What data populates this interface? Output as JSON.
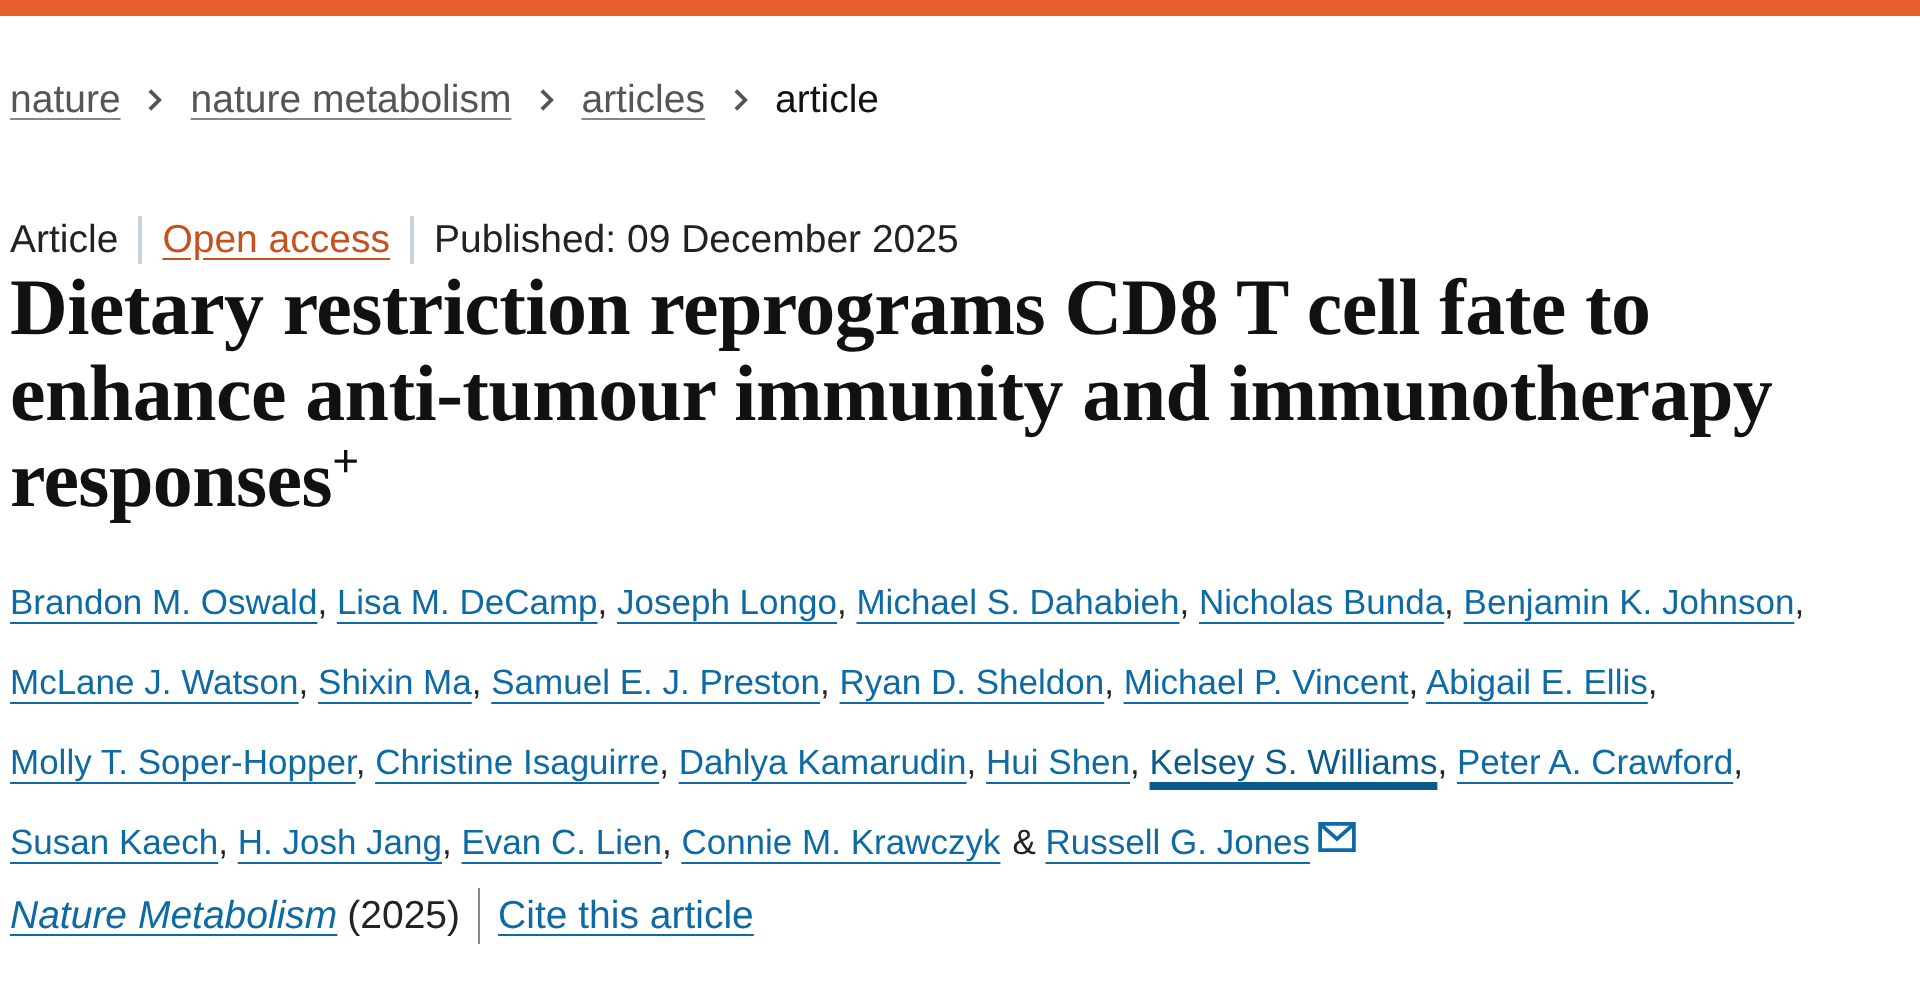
{
  "breadcrumb": [
    {
      "label": "nature",
      "current": false
    },
    {
      "label": "nature metabolism",
      "current": false
    },
    {
      "label": "articles",
      "current": false
    },
    {
      "label": "article",
      "current": true
    }
  ],
  "article_meta": {
    "type": "Article",
    "access": "Open access",
    "published": "Published: 09 December 2025"
  },
  "title": "Dietary restriction reprograms CD8 T cell fate to enhance anti-tumour immunity and immunotherapy responses$^{+}$",
  "authors": [
    {
      "name": "Brandon M. Oswald",
      "after": ",",
      "hovered": false
    },
    {
      "name": "Lisa M. DeCamp",
      "after": ",",
      "hovered": false
    },
    {
      "name": "Joseph Longo",
      "after": ",",
      "hovered": false
    },
    {
      "name": "Michael S. Dahabieh",
      "after": ",",
      "hovered": false
    },
    {
      "name": "Nicholas Bunda",
      "after": ",",
      "hovered": false
    },
    {
      "name": "Benjamin K. Johnson",
      "after": ",",
      "hovered": false
    },
    {
      "name": "McLane J. Watson",
      "after": ",",
      "hovered": false
    },
    {
      "name": "Shixin Ma",
      "after": ",",
      "hovered": false
    },
    {
      "name": "Samuel E. J. Preston",
      "after": ",",
      "hovered": false
    },
    {
      "name": "Ryan D. Sheldon",
      "after": ",",
      "hovered": false
    },
    {
      "name": "Michael P. Vincent",
      "after": ",",
      "hovered": false
    },
    {
      "name": "Abigail E. Ellis",
      "after": ",",
      "hovered": false
    },
    {
      "name": "Molly T. Soper-Hopper",
      "after": ",",
      "hovered": false
    },
    {
      "name": "Christine Isaguirre",
      "after": ",",
      "hovered": false
    },
    {
      "name": "Dahlya Kamarudin",
      "after": ",",
      "hovered": false
    },
    {
      "name": "Hui Shen",
      "after": ",",
      "hovered": false
    },
    {
      "name": "Kelsey S. Williams",
      "after": ",",
      "hovered": true
    },
    {
      "name": "Peter A. Crawford",
      "after": ",",
      "hovered": false
    },
    {
      "name": "Susan Kaech",
      "after": ",",
      "hovered": false
    },
    {
      "name": "H. Josh Jang",
      "after": ",",
      "hovered": false
    },
    {
      "name": "Evan C. Lien",
      "after": ",",
      "hovered": false
    },
    {
      "name": "Connie M. Krawczyk",
      "after": "&",
      "hovered": false
    },
    {
      "name": "Russell G. Jones",
      "hovered": false
    }
  ],
  "citation": {
    "journal": "Nature Metabolism",
    "year": "(2025)",
    "cite_link": "Cite this article"
  }
}
